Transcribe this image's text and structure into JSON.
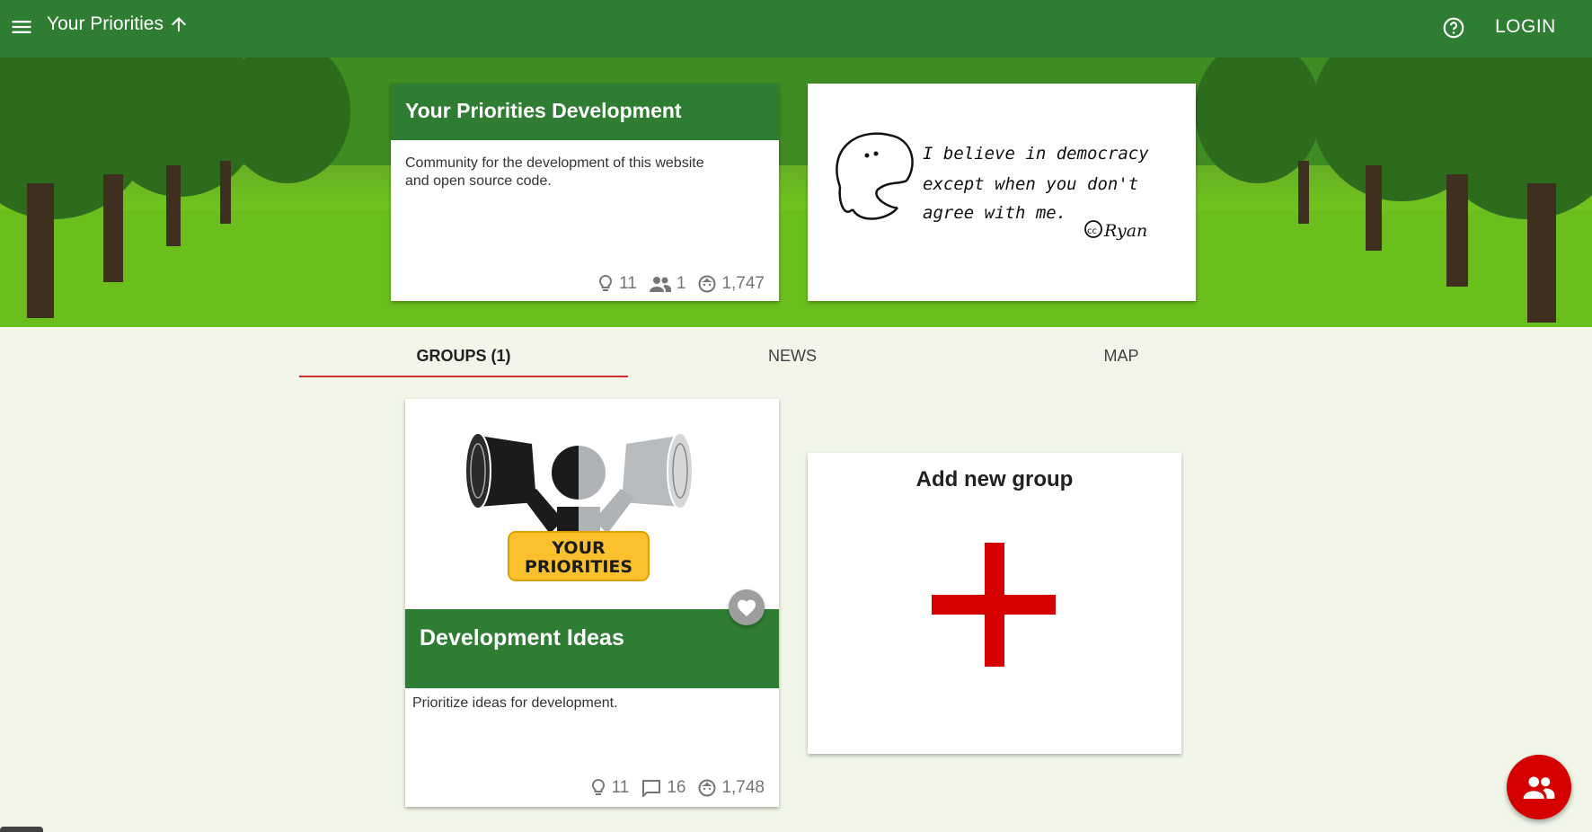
{
  "header": {
    "app_title": "Your Priorities",
    "login_label": "LOGIN"
  },
  "community": {
    "name": "Your Priorities Development",
    "description": "Community for the development of this website and open source code.",
    "stats": {
      "ideas": "11",
      "users": "1",
      "visitors": "1,747"
    },
    "quote_image": {
      "line1": "I believe in democracy",
      "line2": "except when you don't",
      "line3": "agree with me.",
      "credit": "Ryan"
    }
  },
  "tabs": [
    {
      "label": "GROUPS  (1)",
      "active": true
    },
    {
      "label": "NEWS",
      "active": false
    },
    {
      "label": "MAP",
      "active": false
    }
  ],
  "group": {
    "logo_text_line1": "YOUR",
    "logo_text_line2": "PRIORITIES",
    "name": "Development Ideas",
    "description": "Prioritize ideas for development.",
    "stats": {
      "ideas": "11",
      "comments": "16",
      "visitors": "1,748"
    }
  },
  "add_group": {
    "label": "Add new group"
  },
  "colors": {
    "primary": "#2e7d32",
    "accent": "#d50000",
    "background": "#f1f6e9"
  },
  "icons": [
    "menu-icon",
    "arrow-up-icon",
    "help-icon",
    "lightbulb-icon",
    "people-icon",
    "face-icon",
    "comment-icon",
    "heart-icon",
    "plus-icon",
    "group-fab-icon"
  ]
}
